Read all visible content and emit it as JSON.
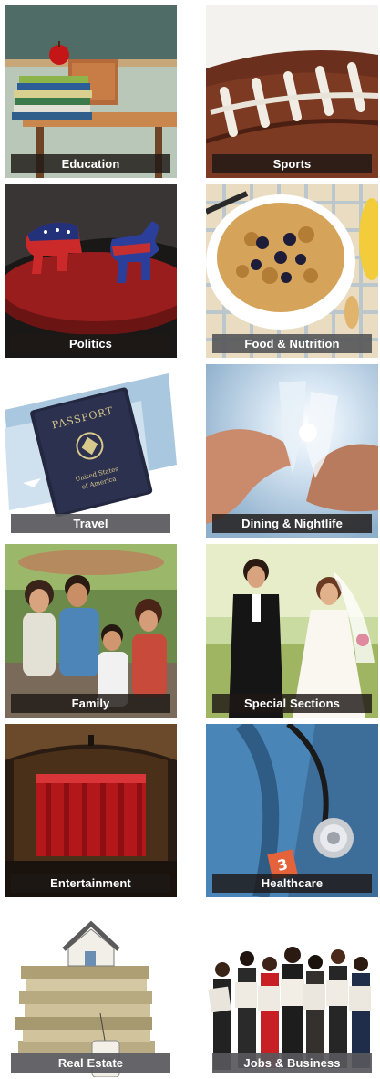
{
  "categories": [
    {
      "key": "education",
      "label": "Education"
    },
    {
      "key": "sports",
      "label": "Sports"
    },
    {
      "key": "politics",
      "label": "Politics"
    },
    {
      "key": "food",
      "label": "Food & Nutrition"
    },
    {
      "key": "travel",
      "label": "Travel"
    },
    {
      "key": "dining",
      "label": "Dining & Nightlife"
    },
    {
      "key": "family",
      "label": "Family"
    },
    {
      "key": "special",
      "label": "Special Sections"
    },
    {
      "key": "entertainment",
      "label": "Entertainment"
    },
    {
      "key": "healthcare",
      "label": "Healthcare"
    },
    {
      "key": "realestate",
      "label": "Real Estate"
    },
    {
      "key": "jobs",
      "label": "Jobs & Business"
    }
  ],
  "passport_text": {
    "title": "PASSPORT",
    "country_line1": "United States",
    "country_line2": "of America"
  },
  "healthcare_badge": "3",
  "price_tag": "$$$",
  "colors": {
    "label_dark": "#1e1816",
    "label_grey": "#58585c",
    "label_text": "#ffffff"
  }
}
